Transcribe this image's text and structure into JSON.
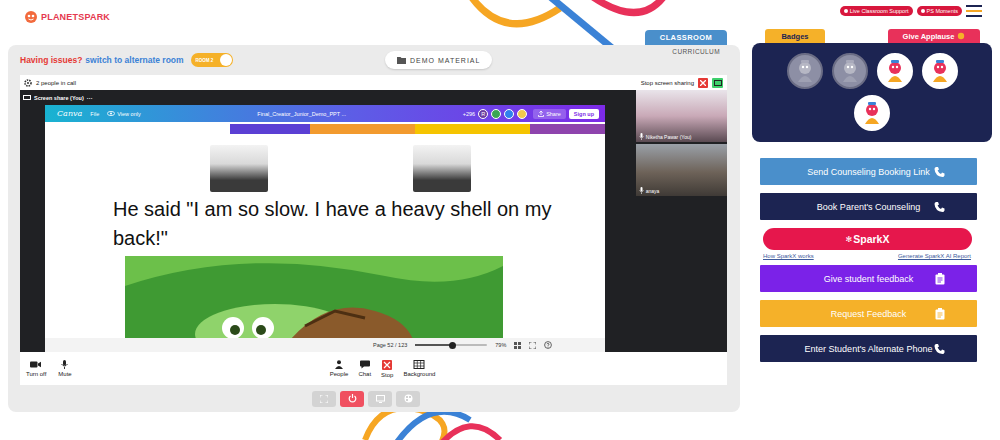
{
  "header": {
    "logo": "PLANETSPARK",
    "pills": [
      "Live Classroom Support",
      "PS Moments"
    ]
  },
  "room_bar": {
    "issue": "Having issues?",
    "link": "switch to alternate room",
    "toggle": {
      "label": "ROOM 2",
      "on": true
    }
  },
  "demo_material": {
    "label": "DEMO MATERIAL"
  },
  "tabs": [
    {
      "label": "CLASSROOM",
      "selected": true
    },
    {
      "label": "CURRICULUM",
      "selected": false
    }
  ],
  "call": {
    "people": "2 people in call",
    "stop_share": "Stop screen sharing",
    "share_label": "Screen share (You)",
    "more": "···"
  },
  "canva": {
    "logo": "Canva",
    "file": "File",
    "view": "View only",
    "title": "Final_Creator_Junior_Demo_PPT ...",
    "count": "+296",
    "avatar": "R",
    "share": "Share",
    "signup": "Sign up",
    "page": "Page 52 / 123",
    "zoom": "79%",
    "zoom_slider": {
      "level": 0.52
    }
  },
  "slide": {
    "text": "He said \"I am so slow. I have a heavy shell on my back!\""
  },
  "participants": [
    {
      "name": "Niketha Pawar (You)"
    },
    {
      "name": "anaya"
    }
  ],
  "toolbar": {
    "left": [
      "Turn off",
      "Mute"
    ],
    "center": [
      "People",
      "Chat",
      "Stop",
      "Background"
    ]
  },
  "badges_tab": "Badges",
  "applause": "Give Applause",
  "badges": [
    {
      "earned": false
    },
    {
      "earned": false
    },
    {
      "earned": true
    },
    {
      "earned": true
    },
    {
      "earned": true
    }
  ],
  "actions_top": [
    {
      "label": "Send Counseling Booking Link",
      "kind": "call",
      "color": "#4a8fcb"
    },
    {
      "label": "Book Parent's Counseling",
      "kind": "call",
      "color": "#1c2452"
    }
  ],
  "sparkx": {
    "icon": "✻",
    "label": "SparkX",
    "links": [
      "How SparkX works",
      "Generate SparkX AI Report"
    ]
  },
  "actions_bottom": [
    {
      "label": "Give student feedback",
      "kind": "form",
      "color": "#7b22e8"
    },
    {
      "label": "Request Feedback",
      "kind": "form",
      "color": "#f5b129"
    },
    {
      "label": "Enter Student's Alternate Phone",
      "kind": "call",
      "color": "#1c2452"
    }
  ]
}
